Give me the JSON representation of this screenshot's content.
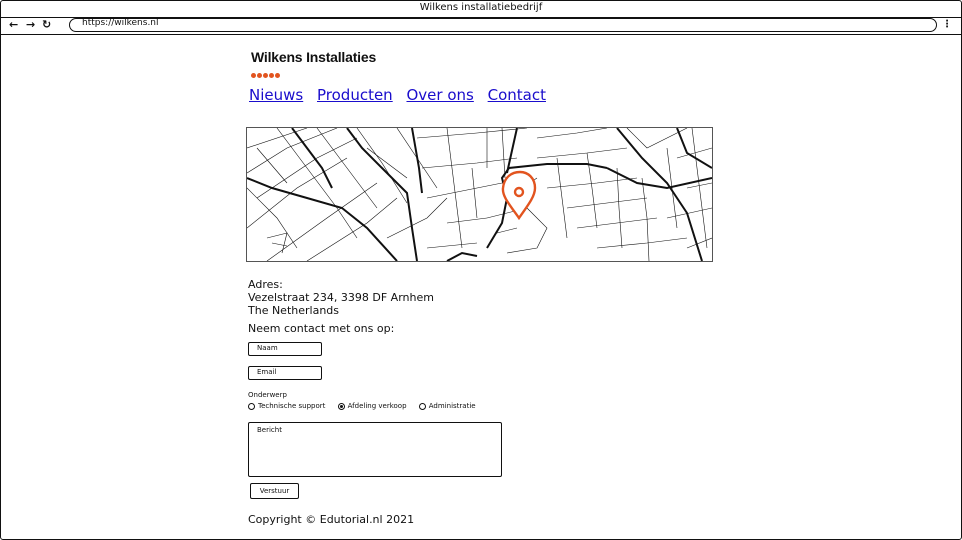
{
  "browser": {
    "window_title": "Wilkens installatiebedrijf",
    "url": "https://wilkens.nl",
    "back_icon": "arrow-left",
    "forward_icon": "arrow-right",
    "reload_icon": "reload",
    "menu_icon": "vertical-dots"
  },
  "logo": {
    "text": "Wilkens Installaties",
    "dot_color": "#e2541f"
  },
  "nav": {
    "items": [
      {
        "label": "Nieuws"
      },
      {
        "label": "Producten"
      },
      {
        "label": "Over ons"
      },
      {
        "label": "Contact"
      }
    ],
    "link_color": "#1a0dcc"
  },
  "map": {
    "marker_icon": "map-pin",
    "marker_color": "#e2541f"
  },
  "address": {
    "label": "Adres:",
    "street": "Vezelstraat 234, 3398 DF Arnhem",
    "country": "The Netherlands"
  },
  "contact": {
    "heading": "Neem contact met ons op:",
    "name_placeholder": "Naam",
    "email_placeholder": "Email",
    "subject_label": "Onderwerp",
    "subject_options": [
      {
        "label": "Technische support",
        "selected": false
      },
      {
        "label": "Afdeling verkoop",
        "selected": true
      },
      {
        "label": "Administratie",
        "selected": false
      }
    ],
    "message_placeholder": "Bericht",
    "submit_label": "Verstuur"
  },
  "footer": {
    "copyright": "Copyright © Edutorial.nl 2021"
  }
}
